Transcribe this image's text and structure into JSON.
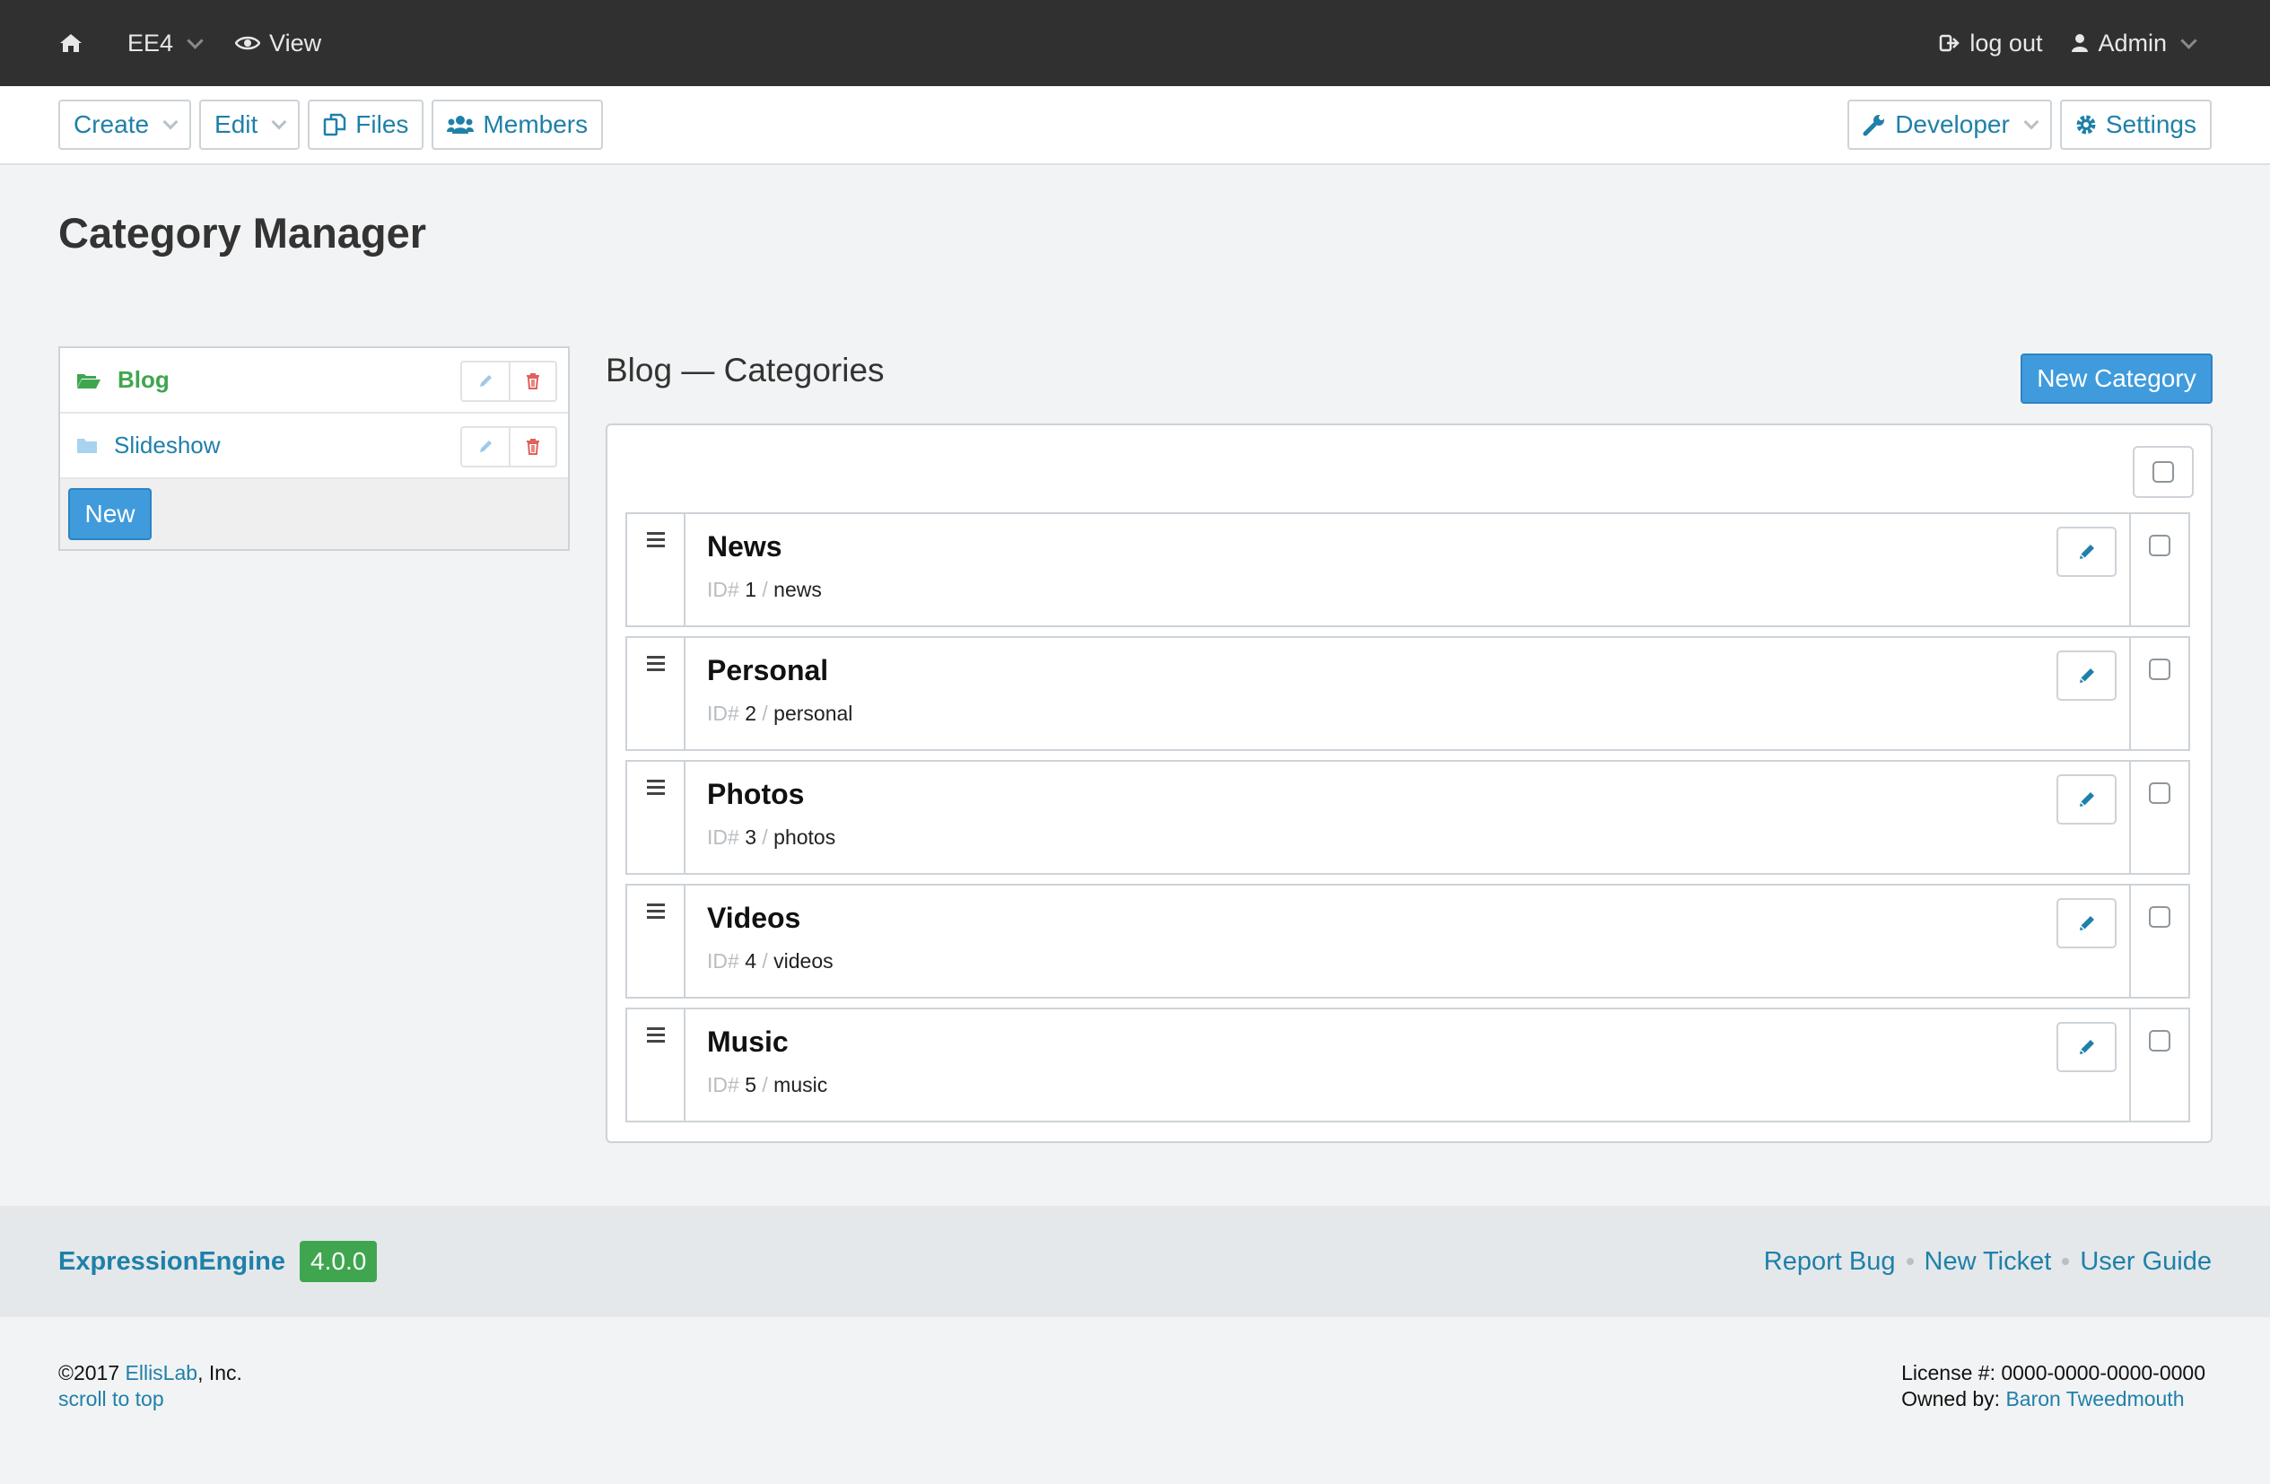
{
  "topbar": {
    "site_name": "EE4",
    "view_label": "View",
    "logout_label": "log out",
    "user_label": "Admin"
  },
  "nav": {
    "create": "Create",
    "edit": "Edit",
    "files": "Files",
    "members": "Members",
    "developer": "Developer",
    "settings": "Settings"
  },
  "page": {
    "title": "Category Manager"
  },
  "sidebar": {
    "items": [
      {
        "label": "Blog",
        "active": true
      },
      {
        "label": "Slideshow",
        "active": false
      }
    ],
    "new_button": "New"
  },
  "main": {
    "title": "Blog — Categories",
    "new_category_button": "New Category",
    "id_prefix": "ID#",
    "separator": "/",
    "categories": [
      {
        "name": "News",
        "id": "1",
        "slug": "news"
      },
      {
        "name": "Personal",
        "id": "2",
        "slug": "personal"
      },
      {
        "name": "Photos",
        "id": "3",
        "slug": "photos"
      },
      {
        "name": "Videos",
        "id": "4",
        "slug": "videos"
      },
      {
        "name": "Music",
        "id": "5",
        "slug": "music"
      }
    ]
  },
  "footer": {
    "brand": "ExpressionEngine",
    "version": "4.0.0",
    "links": [
      "Report Bug",
      "New Ticket",
      "User Guide"
    ],
    "copyright_prefix": "©2017",
    "company_link": "EllisLab",
    "copyright_suffix": ", Inc.",
    "scroll_top": "scroll to top",
    "license": "License #: 0000-0000-0000-0000",
    "owned_by": "Owned by:",
    "owner": "Baron Tweedmouth"
  },
  "colors": {
    "topbar_bg": "#303030",
    "link": "#1f80a9",
    "primary_button": "#3f9bdc",
    "success": "#3fa64f",
    "delete": "#e0605b"
  },
  "icons": [
    "home-icon",
    "eye-icon",
    "logout-icon",
    "user-icon",
    "files-icon",
    "members-icon",
    "wrench-icon",
    "gear-icon",
    "folder-open-icon",
    "folder-icon",
    "pencil-icon",
    "trash-icon",
    "drag-handle-icon"
  ]
}
